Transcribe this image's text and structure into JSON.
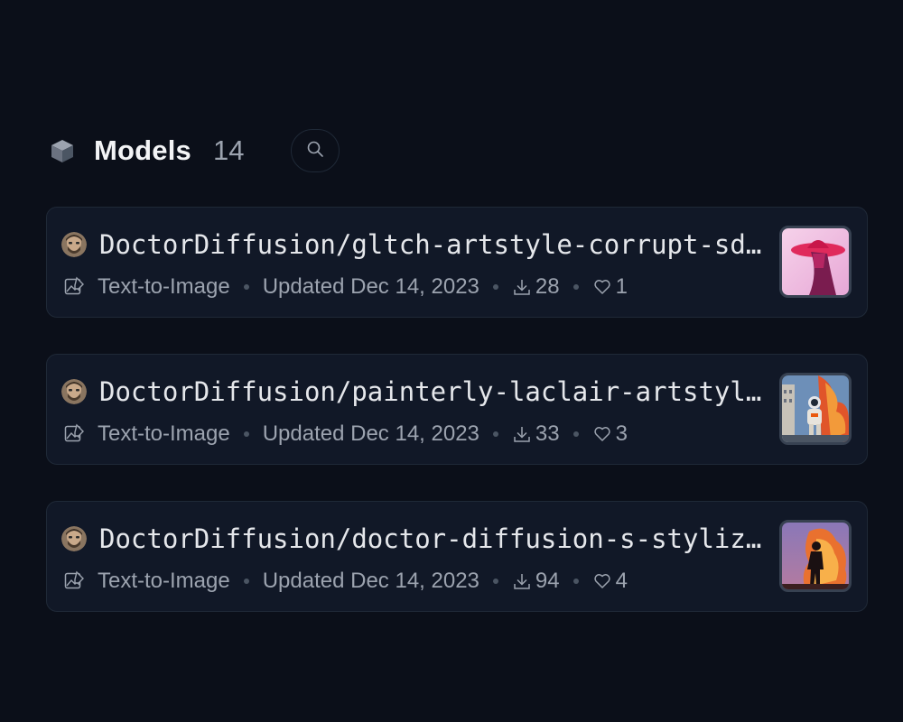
{
  "section": {
    "title": "Models",
    "count": "14",
    "icon": "cube-icon",
    "search_icon": "search-icon"
  },
  "models": [
    {
      "name": "DoctorDiffusion/gltch-artstyle-corrupt-sdxl-lora",
      "task": "Text-to-Image",
      "updated": "Updated Dec 14, 2023",
      "downloads": "28",
      "likes": "1",
      "thumbnail": "pink-figure-hat-thumbnail"
    },
    {
      "name": "DoctorDiffusion/painterly-laclair-artstyle-sdxl-lora",
      "task": "Text-to-Image",
      "updated": "Updated Dec 14, 2023",
      "downloads": "33",
      "likes": "3",
      "thumbnail": "astronaut-fire-city-thumbnail"
    },
    {
      "name": "DoctorDiffusion/doctor-diffusion-s-stylized-silhouette-photography-xl-lora",
      "task": "Text-to-Image",
      "updated": "Updated Dec 14, 2023",
      "downloads": "94",
      "likes": "4",
      "thumbnail": "silhouette-fire-thumbnail"
    }
  ],
  "colors": {
    "background": "#0b0f19",
    "card": "#111827",
    "border": "#1f2937",
    "text": "#e5e7eb",
    "muted": "#9ca3af"
  }
}
